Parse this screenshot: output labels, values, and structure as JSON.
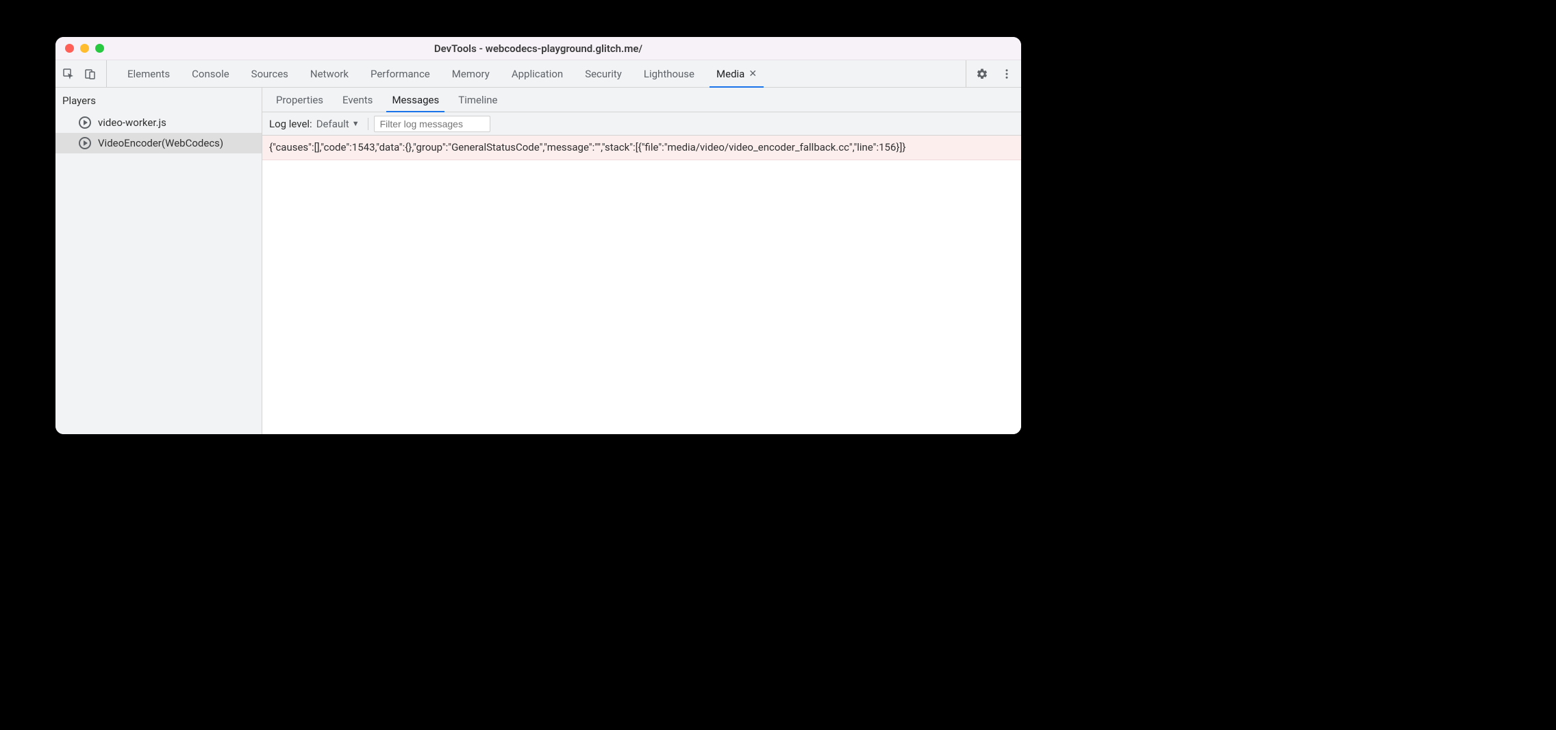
{
  "window": {
    "title": "DevTools - webcodecs-playground.glitch.me/"
  },
  "toolbar": {
    "tabs": [
      {
        "label": "Elements"
      },
      {
        "label": "Console"
      },
      {
        "label": "Sources"
      },
      {
        "label": "Network"
      },
      {
        "label": "Performance"
      },
      {
        "label": "Memory"
      },
      {
        "label": "Application"
      },
      {
        "label": "Security"
      },
      {
        "label": "Lighthouse"
      },
      {
        "label": "Media",
        "active": true,
        "closable": true
      }
    ]
  },
  "sidebar": {
    "header": "Players",
    "players": [
      {
        "label": "video-worker.js"
      },
      {
        "label": "VideoEncoder(WebCodecs)",
        "active": true
      }
    ]
  },
  "subtabs": [
    {
      "label": "Properties"
    },
    {
      "label": "Events"
    },
    {
      "label": "Messages",
      "active": true
    },
    {
      "label": "Timeline"
    }
  ],
  "filterbar": {
    "label": "Log level:",
    "selected": "Default",
    "filter_placeholder": "Filter log messages"
  },
  "messages": [
    {
      "level": "error",
      "text": "{\"causes\":[],\"code\":1543,\"data\":{},\"group\":\"GeneralStatusCode\",\"message\":\"\",\"stack\":[{\"file\":\"media/video/video_encoder_fallback.cc\",\"line\":156}]}"
    }
  ]
}
